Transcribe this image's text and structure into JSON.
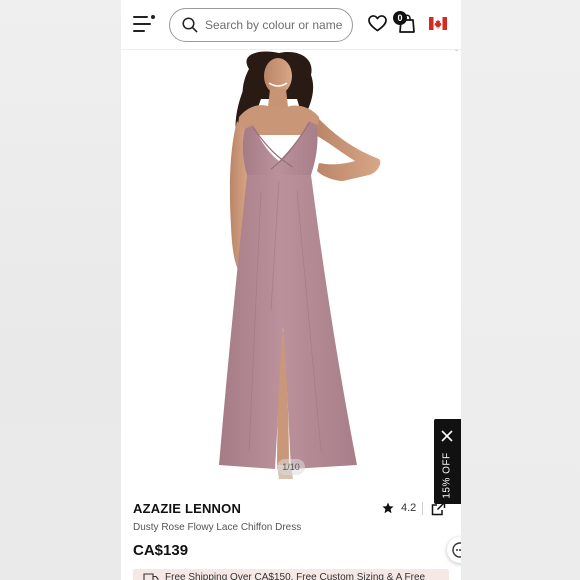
{
  "header": {
    "search_placeholder": "Search by colour or name",
    "cart_count": "0"
  },
  "gallery": {
    "image_counter": "1/10"
  },
  "promo": {
    "label": "15% OFF"
  },
  "product": {
    "brand": "AZAZIE LENNON",
    "name": "Dusty Rose Flowy Lace Chiffon Dress",
    "price": "CA$139",
    "rating": "4.2"
  },
  "shipping_banner": {
    "text": "Free Shipping Over CA$150, Free Custom Sizing & A Free"
  },
  "colors": {
    "dress": "#b58a95",
    "accent": "#111111",
    "banner": "#f6e8e4"
  }
}
